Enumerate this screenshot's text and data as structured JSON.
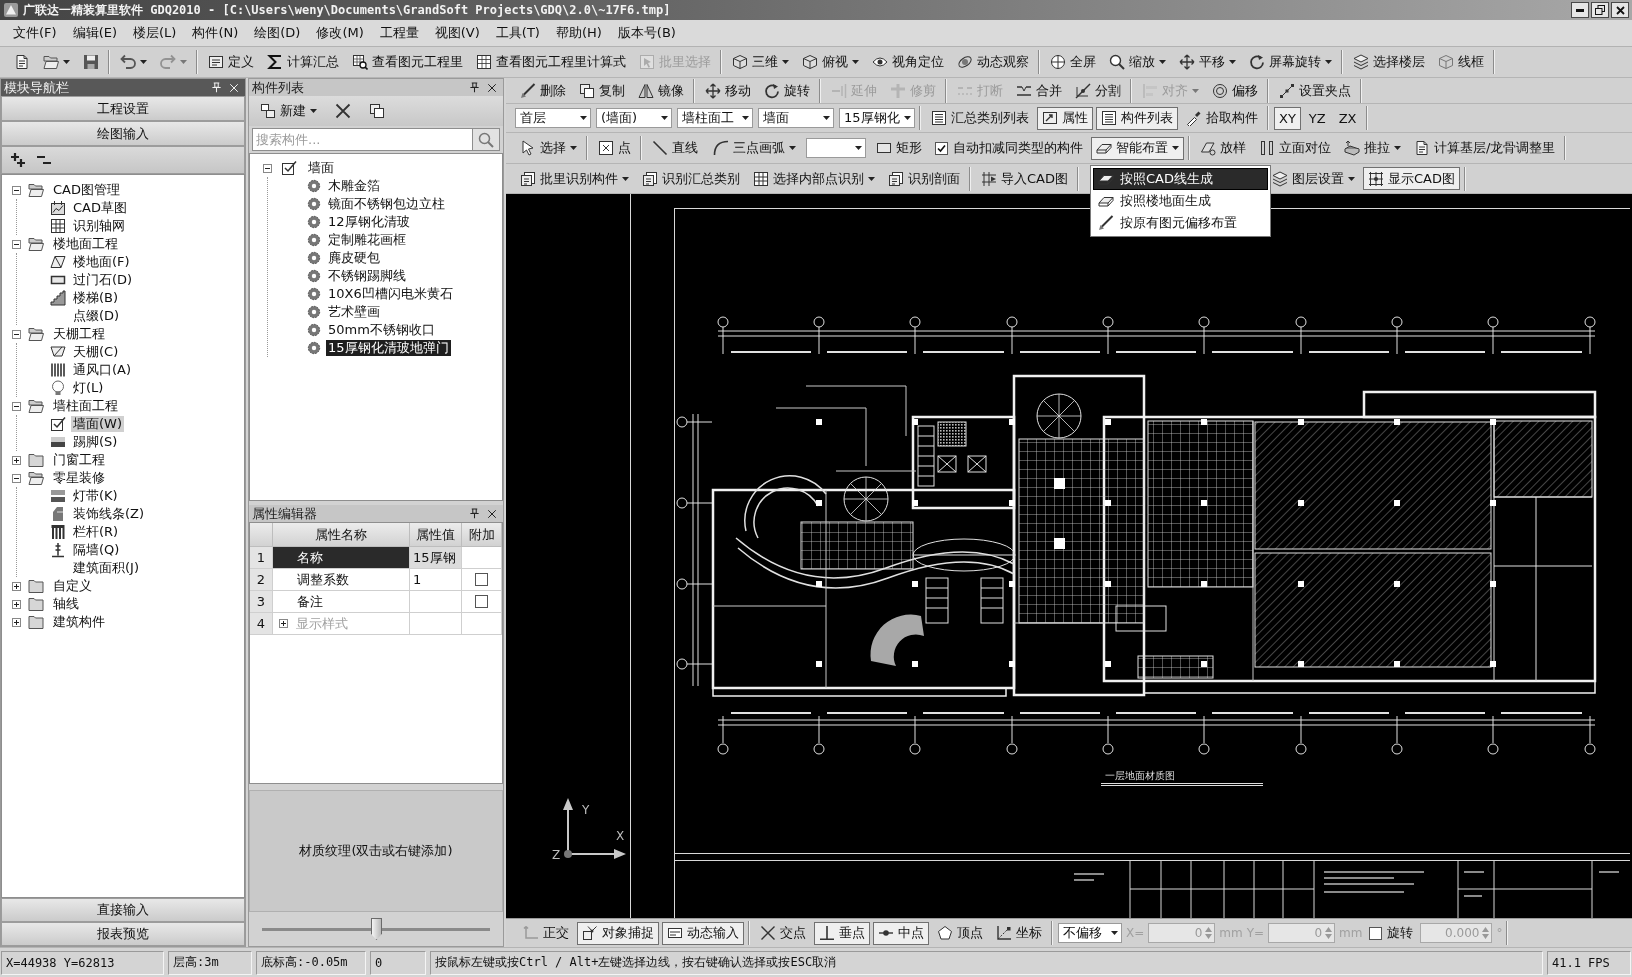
{
  "window": {
    "title": "广联达一精装算里软件 GDQ2010 - [C:\\Users\\weny\\Documents\\GrandSoft Projects\\GDQ\\2.0\\~17F6.tmp]"
  },
  "menu_bar": [
    "文件(F)",
    "编辑(E)",
    "楼层(L)",
    "构件(N)",
    "绘图(D)",
    "修改(M)",
    "工程量",
    "视图(V)",
    "工具(T)",
    "帮助(H)",
    "版本号(B)"
  ],
  "main_toolbar": [
    [
      {
        "menu": false,
        "disabled": false
      },
      {
        "menu": true,
        "disabled": false
      },
      {
        "menu": false,
        "disabled": false
      }
    ],
    [
      {
        "menu": true,
        "disabled": false
      },
      {
        "menu": true,
        "disabled": true
      }
    ],
    [
      {
        "label": "定义",
        "menu": false,
        "disabled": false
      },
      {
        "label": "计算汇总",
        "menu": false,
        "disabled": false
      },
      {
        "label": "查看图元工程里",
        "menu": false,
        "disabled": false
      },
      {
        "label": "查看图元工程里计算式",
        "menu": false,
        "disabled": false
      },
      {
        "label": "批里选择",
        "menu": false,
        "disabled": true
      }
    ],
    [
      {
        "label": "三维",
        "menu": true,
        "disabled": false
      },
      {
        "label": "俯视",
        "menu": true,
        "disabled": false
      },
      {
        "label": "视角定位",
        "menu": false,
        "disabled": false
      },
      {
        "label": "动态观察",
        "menu": false,
        "disabled": false
      }
    ],
    [
      {
        "label": "全屏",
        "menu": false,
        "disabled": false
      },
      {
        "label": "缩放",
        "menu": true,
        "disabled": false
      },
      {
        "label": "平移",
        "menu": true,
        "disabled": false
      },
      {
        "label": "屏幕旋转",
        "menu": true,
        "disabled": false
      }
    ],
    [
      {
        "label": "选择楼层",
        "menu": false,
        "disabled": false
      },
      {
        "label": "线框",
        "menu": false,
        "disabled": false
      }
    ]
  ],
  "module_nav": {
    "title": "模块导航栏",
    "active": true,
    "buttons": [
      "工程设置",
      "绘图输入"
    ],
    "tree": [
      {
        "label": "CAD图管理",
        "expanded": true,
        "selected": false,
        "children": [
          {
            "label": "CAD草图",
            "selected": false
          },
          {
            "label": "识别轴网",
            "selected": false
          }
        ]
      },
      {
        "label": "楼地面工程",
        "expanded": true,
        "selected": false,
        "children": [
          {
            "label": "楼地面(F)",
            "selected": false
          },
          {
            "label": "过门石(D)",
            "selected": false
          },
          {
            "label": "楼梯(B)",
            "selected": false
          },
          {
            "label": "点缀(D)",
            "selected": false
          }
        ]
      },
      {
        "label": "天棚工程",
        "expanded": true,
        "selected": false,
        "children": [
          {
            "label": "天棚(C)",
            "selected": false
          },
          {
            "label": "通风口(A)",
            "selected": false
          },
          {
            "label": "灯(L)",
            "selected": false
          }
        ]
      },
      {
        "label": "墙柱面工程",
        "expanded": true,
        "selected": false,
        "children": [
          {
            "label": "墙面(W)",
            "selected": true
          },
          {
            "label": "踢脚(S)",
            "selected": false
          }
        ]
      },
      {
        "label": "门窗工程",
        "expanded": false,
        "selected": false
      },
      {
        "label": "零星装修",
        "expanded": true,
        "selected": false,
        "children": [
          {
            "label": "灯带(K)",
            "selected": false
          },
          {
            "label": "装饰线条(Z)",
            "selected": false
          },
          {
            "label": "栏杆(R)",
            "selected": false
          },
          {
            "label": "隔墙(Q)",
            "selected": false
          },
          {
            "label": "建筑面积(J)",
            "selected": false
          }
        ]
      },
      {
        "label": "自定义",
        "expanded": false,
        "selected": false
      },
      {
        "label": "轴线",
        "expanded": false,
        "selected": false
      },
      {
        "label": "建筑构件",
        "expanded": false,
        "selected": false
      }
    ],
    "bottom_buttons": [
      "直接输入",
      "报表预览"
    ]
  },
  "component_list": {
    "title": "构件列表",
    "active": false,
    "new_button": "新建",
    "search": {
      "placeholder": "搜索构件..."
    },
    "tree": [
      {
        "label": "墙面",
        "expanded": true,
        "selected": false,
        "children": [
          {
            "label": "木雕金箔",
            "selected": false
          },
          {
            "label": "镜面不锈钢包边立柱",
            "selected": false
          },
          {
            "label": "12厚钢化清玻",
            "selected": false
          },
          {
            "label": "定制雕花画框",
            "selected": false
          },
          {
            "label": "麂皮硬包",
            "selected": false
          },
          {
            "label": "不锈钢踢脚线",
            "selected": false
          },
          {
            "label": "10X6凹槽闪电米黄石",
            "selected": false
          },
          {
            "label": "艺术壁画",
            "selected": false
          },
          {
            "label": "50mm不锈钢收口",
            "selected": false
          },
          {
            "label": "15厚钢化清玻地弹门",
            "selected": true
          }
        ]
      }
    ]
  },
  "property_editor": {
    "title": "属性编辑器",
    "active": false,
    "columns": [
      "属性名称",
      "属性值",
      "附加"
    ],
    "rows": [
      {
        "kind": "field",
        "index": "1",
        "name": "名称",
        "value": "15厚钢",
        "selected": true
      },
      {
        "kind": "field",
        "index": "2",
        "name": "调整系数",
        "value": "1",
        "selected": false,
        "extra": {
          "checked": false
        }
      },
      {
        "kind": "field",
        "index": "3",
        "name": "备注",
        "selected": false,
        "extra": {
          "checked": false
        }
      },
      {
        "kind": "group",
        "index": "4",
        "name": "显示样式",
        "selected": false,
        "expanded": false
      }
    ],
    "texture": "材质纹理(双击或右键添加)",
    "slider": {
      "level": 0.5
    }
  },
  "draw_toolbar": [
    [
      [
        {
          "kind": "button",
          "label": "删除",
          "menu": false,
          "disabled": false,
          "on": false
        },
        {
          "kind": "button",
          "label": "复制",
          "menu": false,
          "disabled": false,
          "on": false
        },
        {
          "kind": "button",
          "label": "镜像",
          "menu": false,
          "disabled": false,
          "on": false
        }
      ],
      [
        {
          "kind": "button",
          "label": "移动",
          "menu": false,
          "disabled": false,
          "on": false
        },
        {
          "kind": "button",
          "label": "旋转",
          "menu": false,
          "disabled": false,
          "on": false
        }
      ],
      [
        {
          "kind": "button",
          "label": "延伸",
          "menu": false,
          "disabled": true,
          "on": false
        },
        {
          "kind": "button",
          "label": "修剪",
          "menu": false,
          "disabled": true,
          "on": false
        }
      ],
      [
        {
          "kind": "button",
          "label": "打断",
          "menu": false,
          "disabled": true,
          "on": false
        },
        {
          "kind": "button",
          "label": "合并",
          "menu": false,
          "disabled": false,
          "on": false
        },
        {
          "kind": "button",
          "label": "分割",
          "menu": false,
          "disabled": false,
          "on": false
        }
      ],
      [
        {
          "kind": "button",
          "label": "对齐",
          "menu": true,
          "disabled": true,
          "on": false
        },
        {
          "kind": "button",
          "label": "偏移",
          "menu": false,
          "disabled": false,
          "on": false
        }
      ],
      [
        {
          "kind": "button",
          "label": "设置夹点",
          "menu": false,
          "disabled": false,
          "on": false
        }
      ]
    ],
    [
      [
        {
          "kind": "combo",
          "value": "首层"
        },
        {
          "kind": "combo",
          "value": "(墙面)"
        },
        {
          "kind": "combo",
          "value": "墙柱面工"
        },
        {
          "kind": "combo",
          "value": "墙面"
        },
        {
          "kind": "combo",
          "value": "15厚钢化"
        }
      ],
      [
        {
          "kind": "button",
          "label": "汇总类别列表",
          "menu": false,
          "disabled": false,
          "on": false
        },
        {
          "kind": "button",
          "label": "属性",
          "menu": false,
          "disabled": false,
          "on": true
        },
        {
          "kind": "button",
          "label": "构件列表",
          "menu": false,
          "disabled": false,
          "on": true
        },
        {
          "kind": "button",
          "label": "拾取构件",
          "menu": false,
          "disabled": false,
          "on": false
        }
      ],
      [
        {
          "kind": "button",
          "label": "XY",
          "menu": false,
          "disabled": false,
          "on": true
        },
        {
          "kind": "button",
          "label": "YZ",
          "menu": false,
          "disabled": false,
          "on": false
        },
        {
          "kind": "button",
          "label": "ZX",
          "menu": false,
          "disabled": false,
          "on": false
        }
      ]
    ],
    [
      [
        {
          "kind": "button",
          "label": "选择",
          "menu": true,
          "disabled": false,
          "on": false
        }
      ],
      [
        {
          "kind": "button",
          "label": "点",
          "menu": false,
          "disabled": false,
          "on": false
        }
      ],
      [
        {
          "kind": "button",
          "label": "直线",
          "menu": false,
          "disabled": false,
          "on": false
        },
        {
          "kind": "button",
          "label": "三点画弧",
          "menu": true,
          "disabled": false,
          "on": false
        },
        {
          "kind": "combo"
        },
        {
          "kind": "button",
          "label": "矩形",
          "menu": false,
          "disabled": false,
          "on": false
        },
        {
          "kind": "checkbox",
          "label": "自动扣减同类型的构件",
          "checked": true
        },
        {
          "kind": "button",
          "label": "智能布置",
          "menu": true,
          "disabled": false,
          "on": true,
          "open_menu": [
            {
              "label": "按照CAD线生成",
              "selected": true
            },
            {
              "label": "按照楼地面生成",
              "selected": false
            },
            {
              "label": "按原有图元偏移布置",
              "selected": false
            }
          ]
        }
      ],
      [
        {
          "kind": "button",
          "label": "放样",
          "menu": false,
          "disabled": false,
          "on": false
        },
        {
          "kind": "button",
          "label": "立面对位",
          "menu": false,
          "disabled": false,
          "on": false
        },
        {
          "kind": "button",
          "label": "推拉",
          "menu": true,
          "disabled": false,
          "on": false
        },
        {
          "kind": "button",
          "label": "计算基层/龙骨调整里",
          "menu": false,
          "disabled": false,
          "on": false
        }
      ]
    ],
    [
      [
        {
          "kind": "button",
          "label": "批里识别构件",
          "menu": true,
          "disabled": false,
          "on": false
        },
        {
          "kind": "button",
          "label": "识别汇总类别",
          "menu": false,
          "disabled": false,
          "on": false
        },
        {
          "kind": "button",
          "label": "选择内部点识别",
          "menu": true,
          "disabled": false,
          "on": false
        },
        {
          "kind": "button",
          "label": "识别剖面",
          "menu": false,
          "disabled": false,
          "on": false
        }
      ],
      [
        {
          "kind": "button",
          "label": "导入CAD图",
          "menu": false,
          "disabled": false,
          "on": false
        }
      ],
      [
        {
          "kind": "button",
          "label": "图层设置",
          "menu": true,
          "disabled": false,
          "on": false
        },
        {
          "kind": "button",
          "label": "显示CAD图",
          "menu": false,
          "disabled": false,
          "on": true
        }
      ]
    ]
  ],
  "cad_view": {
    "drawing_title": "一层地面材质图",
    "axes": {
      "x": "X",
      "y": "Y",
      "z": "Z"
    }
  },
  "snap_toolbar": {
    "modes": [
      [
        {
          "label": "正交",
          "on": false
        },
        {
          "label": "对象捕捉",
          "on": true
        },
        {
          "label": "动态输入",
          "on": true
        }
      ],
      [
        {
          "label": "交点",
          "on": false
        },
        {
          "label": "垂点",
          "on": true
        },
        {
          "label": "中点",
          "on": true
        },
        {
          "label": "顶点",
          "on": false
        },
        {
          "label": "坐标",
          "on": false
        }
      ]
    ],
    "offset": "不偏移",
    "x_label": "X=",
    "x_value": "0",
    "x_unit": "mm",
    "y_label": "Y=",
    "y_value": "0",
    "y_unit": "mm",
    "rotate": {
      "label": "旋转",
      "checked": false
    },
    "angle": "0.000",
    "angle_unit": "°",
    "inputs_disabled": true
  },
  "status_bar": [
    "X=44938 Y=62813",
    "层高:3m",
    "底标高:-0.05m",
    "0",
    "按鼠标左键或按Ctrl / Alt+左键选择边线，按右键确认选择或按ESC取消",
    "41.1 FPS"
  ]
}
